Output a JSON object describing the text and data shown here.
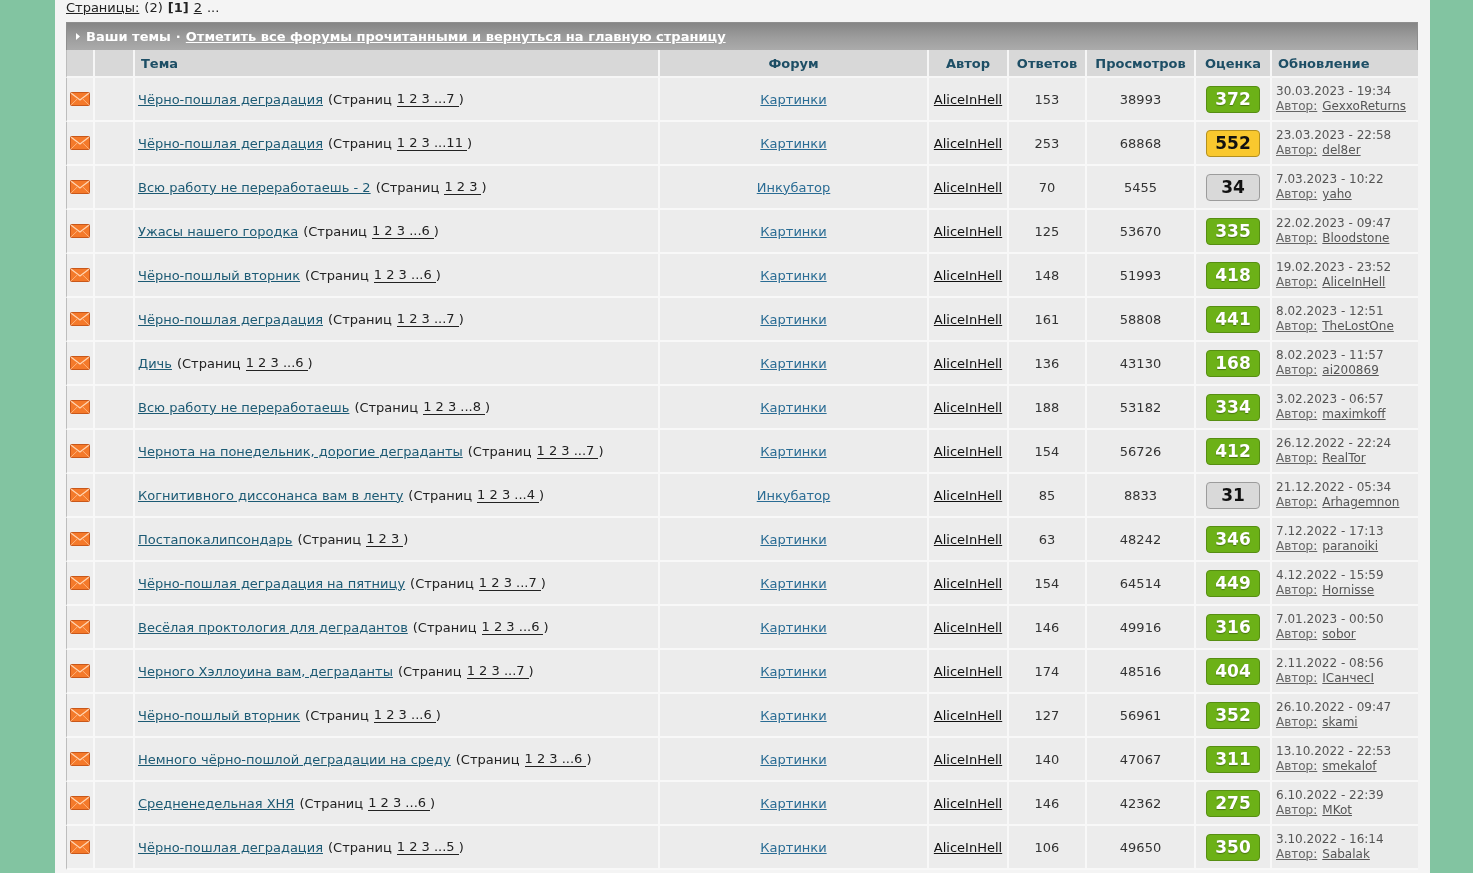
{
  "pagination": {
    "label": "Страницы:",
    "count": "(2)",
    "pages": [
      {
        "label": "[1]",
        "selected": true
      },
      {
        "label": "2",
        "selected": false
      }
    ],
    "more": "..."
  },
  "section": {
    "title": "Ваши темы",
    "separator": "·",
    "mark_read_link": "Отметить все форумы прочитанными и вернуться на главную страницу"
  },
  "table": {
    "columns": [
      "Тема",
      "Форум",
      "Автор",
      "Ответов",
      "Просмотров",
      "Оценка",
      "Обновление"
    ],
    "rows": [
      {
        "topic": {
          "title": "Чёрно-пошлая деградация",
          "pages_label": "(Страниц",
          "pages": "1 2 3 ...7",
          "pages_end": ")"
        },
        "forum": "Картинки",
        "author": "AliceInHell",
        "replies": "153",
        "views": "38993",
        "rating": "372",
        "color": "#6cb117",
        "updated": "30.03.2023 - 19:34",
        "last_post_label": "Автор:",
        "last_poster": "GexxoReturns"
      },
      {
        "topic": {
          "title": "Чёрно-пошлая деградация",
          "pages_label": "(Страниц",
          "pages": "1 2 3 ...11",
          "pages_end": ")"
        },
        "forum": "Картинки",
        "author": "AliceInHell",
        "replies": "253",
        "views": "68868",
        "rating": "552",
        "color": "#f9c82e",
        "updated": "23.03.2023 - 22:58",
        "last_post_label": "Автор:",
        "last_poster": "del8er"
      },
      {
        "topic": {
          "title": "Всю работу не переработаешь - 2",
          "pages_label": "(Страниц",
          "pages": "1 2 3",
          "pages_end": ")"
        },
        "forum": "Инкубатор",
        "author": "AliceInHell",
        "replies": "70",
        "views": "5455",
        "rating": "34",
        "color": "#d9d9d9",
        "updated": "7.03.2023 - 10:22",
        "last_post_label": "Автор:",
        "last_poster": "yaho"
      },
      {
        "topic": {
          "title": "Ужасы нашего городка",
          "pages_label": "(Страниц",
          "pages": "1 2 3 ...6",
          "pages_end": ")"
        },
        "forum": "Картинки",
        "author": "AliceInHell",
        "replies": "125",
        "views": "53670",
        "rating": "335",
        "color": "#6cb117",
        "updated": "22.02.2023 - 09:47",
        "last_post_label": "Автор:",
        "last_poster": "Bloodstone"
      },
      {
        "topic": {
          "title": "Чёрно-пошлый вторник",
          "pages_label": "(Страниц",
          "pages": "1 2 3 ...6",
          "pages_end": ")"
        },
        "forum": "Картинки",
        "author": "AliceInHell",
        "replies": "148",
        "views": "51993",
        "rating": "418",
        "color": "#6cb117",
        "updated": "19.02.2023 - 23:52",
        "last_post_label": "Автор:",
        "last_poster": "AliceInHell"
      },
      {
        "topic": {
          "title": "Чёрно-пошлая деградация",
          "pages_label": "(Страниц",
          "pages": "1 2 3 ...7",
          "pages_end": ")"
        },
        "forum": "Картинки",
        "author": "AliceInHell",
        "replies": "161",
        "views": "58808",
        "rating": "441",
        "color": "#6cb117",
        "updated": "8.02.2023 - 12:51",
        "last_post_label": "Автор:",
        "last_poster": "TheLostOne"
      },
      {
        "topic": {
          "title": "Дичь",
          "pages_label": "(Страниц",
          "pages": "1 2 3 ...6",
          "pages_end": ")"
        },
        "forum": "Картинки",
        "author": "AliceInHell",
        "replies": "136",
        "views": "43130",
        "rating": "168",
        "color": "#6cb117",
        "updated": "8.02.2023 - 11:57",
        "last_post_label": "Автор:",
        "last_poster": "ai200869"
      },
      {
        "topic": {
          "title": "Всю работу не переработаешь",
          "pages_label": "(Страниц",
          "pages": "1 2 3 ...8",
          "pages_end": ")"
        },
        "forum": "Картинки",
        "author": "AliceInHell",
        "replies": "188",
        "views": "53182",
        "rating": "334",
        "color": "#6cb117",
        "updated": "3.02.2023 - 06:57",
        "last_post_label": "Автор:",
        "last_poster": "maximkoff"
      },
      {
        "topic": {
          "title": "Чернота на понедельник, дорогие деграданты",
          "pages_label": "(Страниц",
          "pages": "1 2 3 ...7",
          "pages_end": ")"
        },
        "forum": "Картинки",
        "author": "AliceInHell",
        "replies": "154",
        "views": "56726",
        "rating": "412",
        "color": "#6cb117",
        "updated": "26.12.2022 - 22:24",
        "last_post_label": "Автор:",
        "last_poster": "RealTor"
      },
      {
        "topic": {
          "title": "Когнитивного диссонанса вам в ленту",
          "pages_label": "(Страниц",
          "pages": "1 2 3 ...4",
          "pages_end": ")"
        },
        "forum": "Инкубатор",
        "author": "AliceInHell",
        "replies": "85",
        "views": "8833",
        "rating": "31",
        "color": "#d9d9d9",
        "updated": "21.12.2022 - 05:34",
        "last_post_label": "Автор:",
        "last_poster": "Arhagemnon"
      },
      {
        "topic": {
          "title": "Постапокалипсондарь",
          "pages_label": "(Страниц",
          "pages": "1 2 3",
          "pages_end": ")"
        },
        "forum": "Картинки",
        "author": "AliceInHell",
        "replies": "63",
        "views": "48242",
        "rating": "346",
        "color": "#6cb117",
        "updated": "7.12.2022 - 17:13",
        "last_post_label": "Автор:",
        "last_poster": "paranoiki"
      },
      {
        "topic": {
          "title": "Чёрно-пошлая деградация на пятницу",
          "pages_label": "(Страниц",
          "pages": "1 2 3 ...7",
          "pages_end": ")"
        },
        "forum": "Картинки",
        "author": "AliceInHell",
        "replies": "154",
        "views": "64514",
        "rating": "449",
        "color": "#6cb117",
        "updated": "4.12.2022 - 15:59",
        "last_post_label": "Автор:",
        "last_poster": "Hornisse"
      },
      {
        "topic": {
          "title": "Весёлая проктология для деградантов",
          "pages_label": "(Страниц",
          "pages": "1 2 3 ...6",
          "pages_end": ")"
        },
        "forum": "Картинки",
        "author": "AliceInHell",
        "replies": "146",
        "views": "49916",
        "rating": "316",
        "color": "#6cb117",
        "updated": "7.01.2023 - 00:50",
        "last_post_label": "Автор:",
        "last_poster": "sobor"
      },
      {
        "topic": {
          "title": "Черного Хэллоуина вам, деграданты",
          "pages_label": "(Страниц",
          "pages": "1 2 3 ...7",
          "pages_end": ")"
        },
        "forum": "Картинки",
        "author": "AliceInHell",
        "replies": "174",
        "views": "48516",
        "rating": "404",
        "color": "#6cb117",
        "updated": "2.11.2022 - 08:56",
        "last_post_label": "Автор:",
        "last_poster": "IСанчесI"
      },
      {
        "topic": {
          "title": "Чёрно-пошлый вторник",
          "pages_label": "(Страниц",
          "pages": "1 2 3 ...6",
          "pages_end": ")"
        },
        "forum": "Картинки",
        "author": "AliceInHell",
        "replies": "127",
        "views": "56961",
        "rating": "352",
        "color": "#6cb117",
        "updated": "26.10.2022 - 09:47",
        "last_post_label": "Автор:",
        "last_poster": "skami"
      },
      {
        "topic": {
          "title": "Немного чёрно-пошлой деградации на среду",
          "pages_label": "(Страниц",
          "pages": "1 2 3 ...6",
          "pages_end": ")"
        },
        "forum": "Картинки",
        "author": "AliceInHell",
        "replies": "140",
        "views": "47067",
        "rating": "311",
        "color": "#6cb117",
        "updated": "13.10.2022 - 22:53",
        "last_post_label": "Автор:",
        "last_poster": "smekalof"
      },
      {
        "topic": {
          "title": "Средненедельная ХНЯ",
          "pages_label": "(Страниц",
          "pages": "1 2 3 ...6",
          "pages_end": ")"
        },
        "forum": "Картинки",
        "author": "AliceInHell",
        "replies": "146",
        "views": "42362",
        "rating": "275",
        "color": "#6cb117",
        "updated": "6.10.2022 - 22:39",
        "last_post_label": "Автор:",
        "last_poster": "MKot"
      },
      {
        "topic": {
          "title": "Чёрно-пошлая деградация",
          "pages_label": "(Страниц",
          "pages": "1 2 3 ...5",
          "pages_end": ")"
        },
        "forum": "Картинки",
        "author": "AliceInHell",
        "replies": "106",
        "views": "49650",
        "rating": "350",
        "color": "#6cb117",
        "updated": "3.10.2022 - 16:14",
        "last_post_label": "Автор:",
        "last_poster": "Sabalak"
      }
    ]
  }
}
